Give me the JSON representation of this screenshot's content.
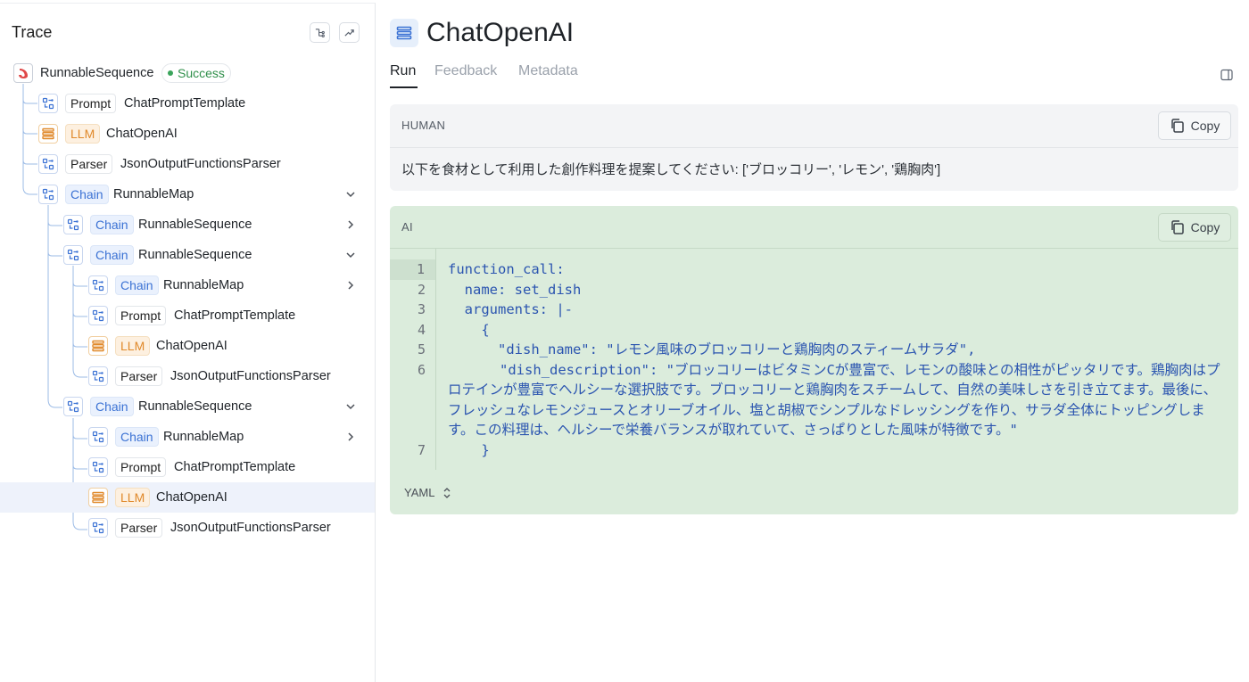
{
  "trace_panel": {
    "title": "Trace",
    "tree": [
      {
        "kind": "root",
        "label": "RunnableSequence",
        "status": "Success"
      },
      {
        "kind": "prompt",
        "badge": "Prompt",
        "label": "ChatPromptTemplate"
      },
      {
        "kind": "llm",
        "badge": "LLM",
        "label": "ChatOpenAI"
      },
      {
        "kind": "parser",
        "badge": "Parser",
        "label": "JsonOutputFunctionsParser"
      },
      {
        "kind": "chain",
        "badge": "Chain",
        "label": "RunnableMap",
        "expanded": true
      },
      {
        "kind": "chain",
        "badge": "Chain",
        "label": "RunnableSequence",
        "expanded": false
      },
      {
        "kind": "chain",
        "badge": "Chain",
        "label": "RunnableSequence",
        "expanded": true
      },
      {
        "kind": "chain",
        "badge": "Chain",
        "label": "RunnableMap",
        "expanded": false
      },
      {
        "kind": "prompt",
        "badge": "Prompt",
        "label": "ChatPromptTemplate"
      },
      {
        "kind": "llm",
        "badge": "LLM",
        "label": "ChatOpenAI"
      },
      {
        "kind": "parser",
        "badge": "Parser",
        "label": "JsonOutputFunctionsParser"
      },
      {
        "kind": "chain",
        "badge": "Chain",
        "label": "RunnableSequence",
        "expanded": true
      },
      {
        "kind": "chain",
        "badge": "Chain",
        "label": "RunnableMap",
        "expanded": false
      },
      {
        "kind": "prompt",
        "badge": "Prompt",
        "label": "ChatPromptTemplate"
      },
      {
        "kind": "llm",
        "badge": "LLM",
        "label": "ChatOpenAI",
        "selected": true
      },
      {
        "kind": "parser",
        "badge": "Parser",
        "label": "JsonOutputFunctionsParser"
      }
    ]
  },
  "detail": {
    "title": "ChatOpenAI",
    "tabs": [
      "Run",
      "Feedback",
      "Metadata"
    ],
    "active_tab": "Run",
    "human": {
      "role": "HUMAN",
      "copy_label": "Copy",
      "text": "以下を食材として利用した創作料理を提案してください: ['ブロッコリー', 'レモン', '鶏胸肉']"
    },
    "ai": {
      "role": "AI",
      "copy_label": "Copy",
      "format_label": "YAML",
      "code_lines": [
        {
          "num": "1",
          "text": "function_call:"
        },
        {
          "num": "2",
          "text": "  name: set_dish"
        },
        {
          "num": "3",
          "text": "  arguments: |-"
        },
        {
          "num": "4",
          "text": "    {"
        },
        {
          "num": "5",
          "text": "      \"dish_name\": \"レモン風味のブロッコリーと鶏胸肉のスティームサラダ\","
        },
        {
          "num": "6",
          "text": "      \"dish_description\": \"ブロッコリーはビタミンCが豊富で、レモンの酸味との相性がピッタリです。鶏胸肉はプロテインが豊富でヘルシーな選択肢です。ブロッコリーと鶏胸肉をスチームして、自然の美味しさを引き立てます。最後に、フレッシュなレモンジュースとオリーブオイル、塩と胡椒でシンプルなドレッシングを作り、サラダ全体にトッピングします。この料理は、ヘルシーで栄養バランスが取れていて、さっぱりとした風味が特徴です。\""
        },
        {
          "num": "7",
          "text": "    }"
        }
      ]
    }
  },
  "colors": {
    "chain_accent": "#3b72d4",
    "llm_accent": "#e0892a",
    "success": "#2f8f4a",
    "ai_background": "#dbecdc",
    "human_background": "#f3f4f6",
    "code_text": "#2b55b0"
  }
}
